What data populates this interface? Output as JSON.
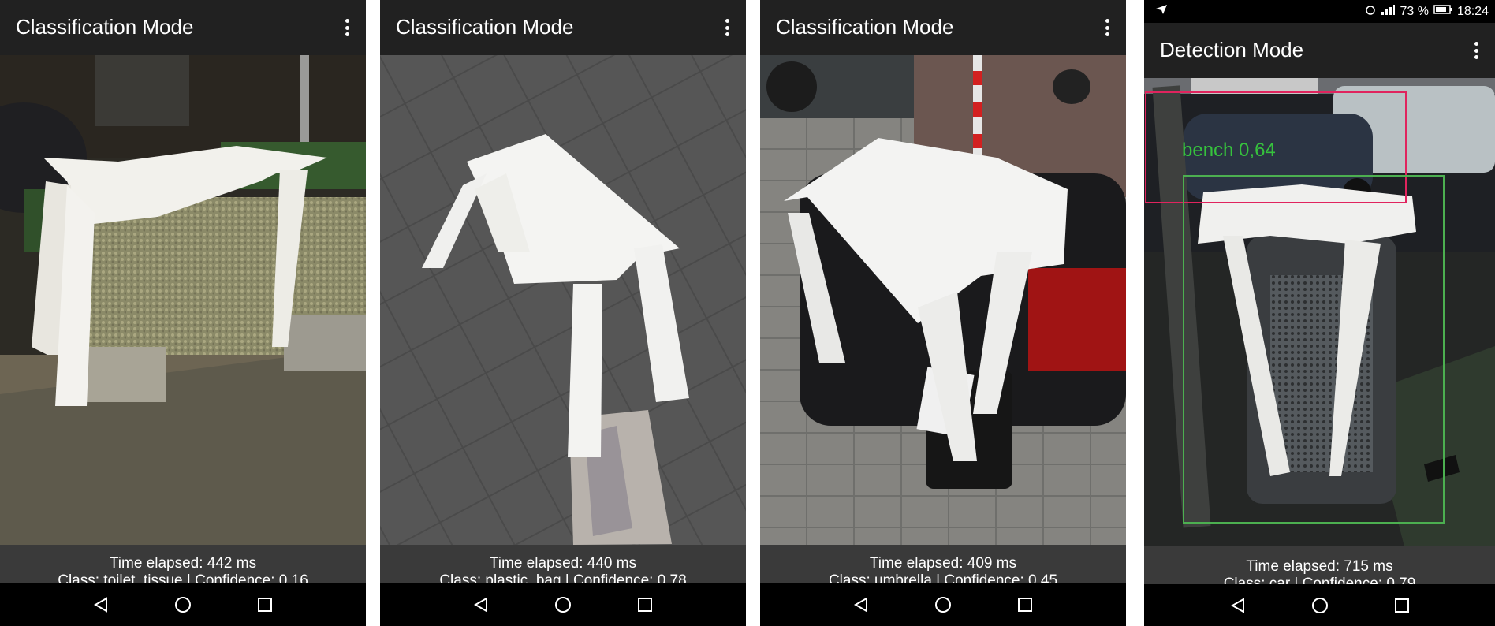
{
  "panels": [
    {
      "title": "Classification Mode",
      "time": "Time elapsed: 442 ms",
      "result": "Class: toilet_tissue | Confidence: 0.16"
    },
    {
      "title": "Classification Mode",
      "time": "Time elapsed: 440 ms",
      "result": "Class: plastic_bag | Confidence: 0.78"
    },
    {
      "title": "Classification Mode",
      "time": "Time elapsed: 409 ms",
      "result": "Class: umbrella | Confidence: 0.45"
    },
    {
      "title": "Detection Mode",
      "time": "Time elapsed: 715 ms",
      "result": "Class: car | Confidence: 0.79",
      "status": {
        "icons_left": "send-icon",
        "battery": "73 %",
        "clock": "18:24"
      },
      "detections": [
        {
          "label": "bench 0,64",
          "color": "#4caf50"
        },
        {
          "label": "",
          "color": "#e0245e"
        }
      ]
    }
  ],
  "colors": {
    "appbar": "#212121",
    "info": "#3a3a3a",
    "navbar": "#000000"
  }
}
